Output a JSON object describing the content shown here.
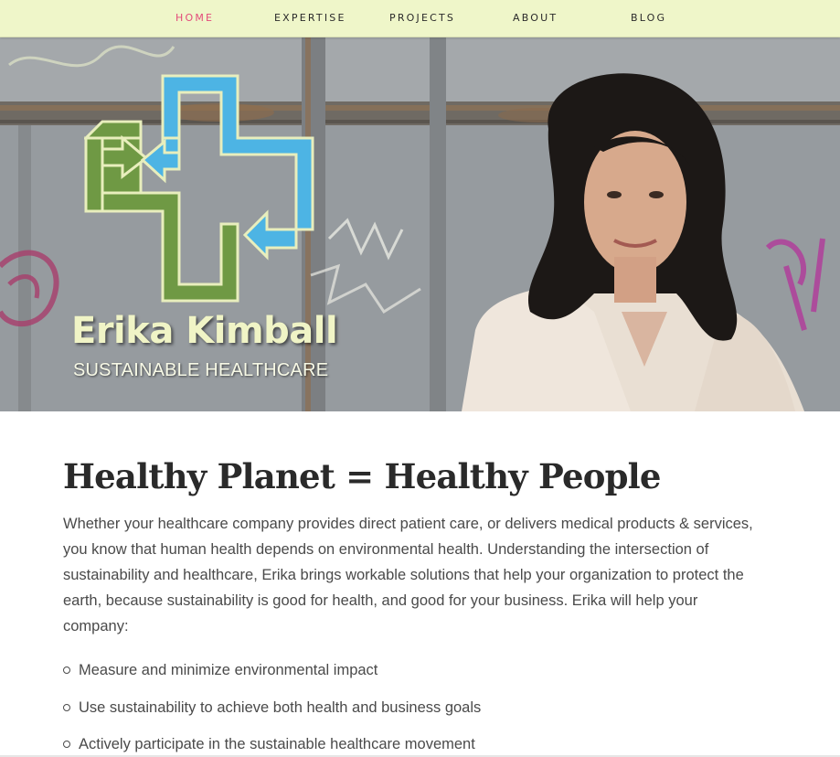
{
  "nav": {
    "items": [
      {
        "label": "HOME",
        "active": true
      },
      {
        "label": "EXPERTISE",
        "active": false
      },
      {
        "label": "PROJECTS",
        "active": false
      },
      {
        "label": "ABOUT",
        "active": false
      },
      {
        "label": "BLOG",
        "active": false
      }
    ]
  },
  "hero": {
    "logo_icon": "recycling-medical-cross-icon",
    "name": "Erika Kimball",
    "tagline": "SUSTAINABLE HEALTHCARE",
    "photo": "portrait-photo"
  },
  "main": {
    "headline": "Healthy Planet = Healthy People",
    "intro": "Whether your healthcare company provides direct patient care, or delivers medical products & services, you know that human health depends on environmental health. Understanding the intersection of sustainability and healthcare, Erika brings workable solutions that help your organization to protect the earth, because sustainability is good for health, and good for your business. Erika will help your company:",
    "bullets": [
      "Measure and minimize environmental impact",
      "Use sustainability to achieve both health and business goals",
      "Actively participate in the sustainable healthcare movement"
    ]
  },
  "colors": {
    "nav_bg": "#eff6c9",
    "nav_active": "#e34b7b",
    "logo_blue": "#4db4e4",
    "logo_green": "#6f9944",
    "name_color": "#f0f4c6"
  }
}
